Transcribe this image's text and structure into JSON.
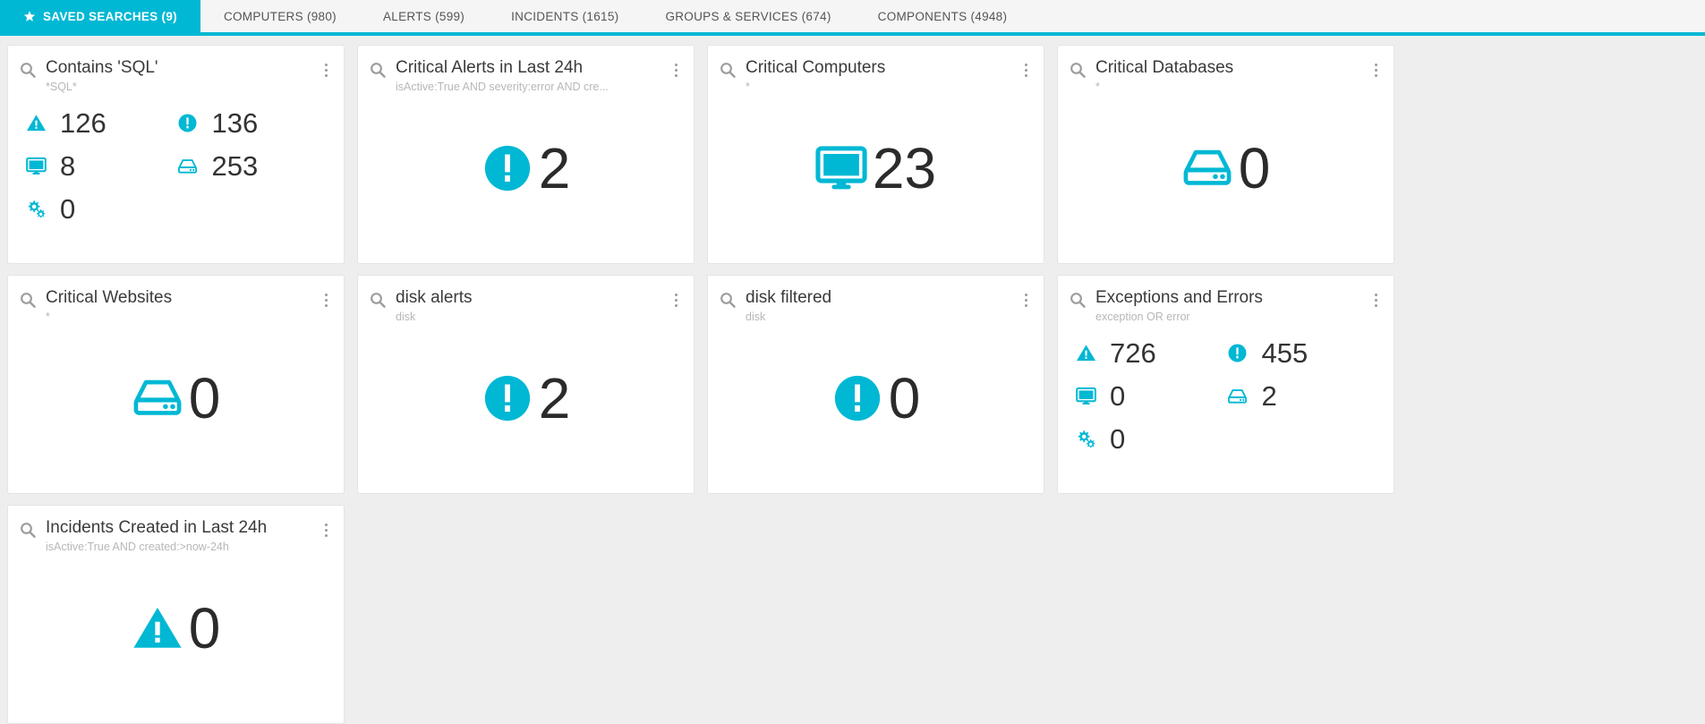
{
  "nav": {
    "tabs": [
      {
        "label": "SAVED SEARCHES (9)",
        "active": true,
        "icon": "star-icon"
      },
      {
        "label": "COMPUTERS (980)",
        "active": false
      },
      {
        "label": "ALERTS (599)",
        "active": false
      },
      {
        "label": "INCIDENTS (1615)",
        "active": false
      },
      {
        "label": "GROUPS & SERVICES (674)",
        "active": false
      },
      {
        "label": "COMPONENTS (4948)",
        "active": false
      }
    ]
  },
  "colors": {
    "accent": "#00b8d4",
    "nav_background": "#f5f5f5",
    "board_background": "#eeeeee",
    "card_background": "#ffffff",
    "title_text": "#3a3a3a",
    "subtitle_text": "#b7b7b7",
    "value_text": "#2b2b2b"
  },
  "cards": [
    {
      "title": "Contains 'SQL'",
      "subtitle": "*SQL*",
      "layout": "stats",
      "stats": [
        {
          "icon": "warning-triangle-icon",
          "value": "126"
        },
        {
          "icon": "exclamation-circle-icon",
          "value": "136"
        },
        {
          "icon": "monitor-icon",
          "value": "8"
        },
        {
          "icon": "harddrive-icon",
          "value": "253"
        },
        {
          "icon": "gears-icon",
          "value": "0"
        }
      ]
    },
    {
      "title": "Critical Alerts in Last 24h",
      "subtitle": "isActive:True AND severity:error AND cre...",
      "layout": "big",
      "big": {
        "icon": "exclamation-circle-icon",
        "value": "2"
      }
    },
    {
      "title": "Critical Computers",
      "subtitle": "*",
      "layout": "big",
      "big": {
        "icon": "monitor-icon",
        "value": "23"
      }
    },
    {
      "title": "Critical Databases",
      "subtitle": "*",
      "layout": "big",
      "big": {
        "icon": "harddrive-icon",
        "value": "0"
      }
    },
    {
      "title": "Critical Websites",
      "subtitle": "*",
      "layout": "big",
      "big": {
        "icon": "harddrive-icon",
        "value": "0"
      }
    },
    {
      "title": "disk alerts",
      "subtitle": "disk",
      "layout": "big",
      "big": {
        "icon": "exclamation-circle-icon",
        "value": "2"
      }
    },
    {
      "title": "disk filtered",
      "subtitle": "disk",
      "layout": "big",
      "big": {
        "icon": "exclamation-circle-icon",
        "value": "0"
      }
    },
    {
      "title": "Exceptions and Errors",
      "subtitle": "exception OR error",
      "layout": "stats",
      "stats": [
        {
          "icon": "warning-triangle-icon",
          "value": "726"
        },
        {
          "icon": "exclamation-circle-icon",
          "value": "455"
        },
        {
          "icon": "monitor-icon",
          "value": "0"
        },
        {
          "icon": "harddrive-icon",
          "value": "2"
        },
        {
          "icon": "gears-icon",
          "value": "0"
        }
      ]
    },
    {
      "title": "Incidents Created in Last 24h",
      "subtitle": "isActive:True AND created:>now-24h",
      "layout": "big",
      "big": {
        "icon": "warning-triangle-icon",
        "value": "0"
      }
    }
  ]
}
